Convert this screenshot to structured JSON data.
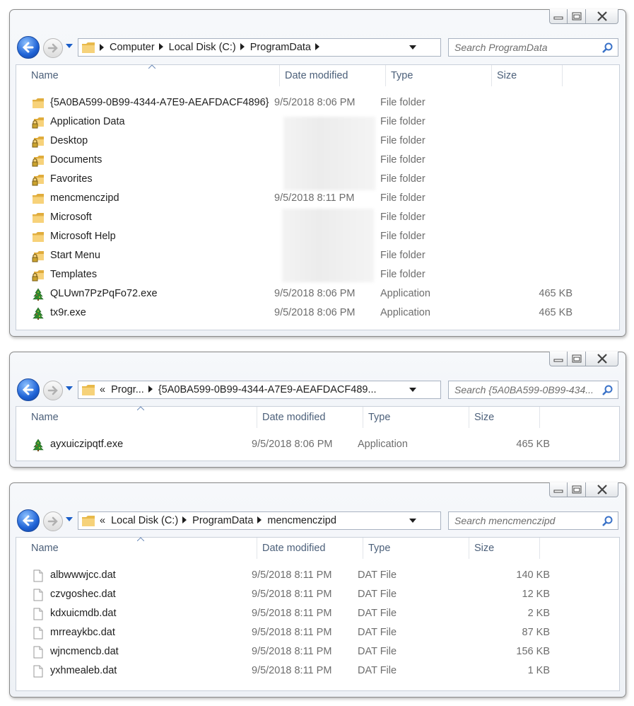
{
  "windows": [
    {
      "id": "w1",
      "address": [
        "Computer",
        "Local Disk (C:)",
        "ProgramData"
      ],
      "address_prefix": "",
      "search_placeholder": "Search ProgramData",
      "columns": {
        "name": "Name",
        "date": "Date modified",
        "type": "Type",
        "size": "Size"
      },
      "rows": [
        {
          "icon": "folder-icon",
          "name": "{5A0BA599-0B99-4344-A7E9-AEAFDACF4896}",
          "date": "9/5/2018 8:06 PM",
          "type": "File folder",
          "size": ""
        },
        {
          "icon": "locked-folder-icon",
          "name": "Application Data",
          "date": "",
          "type": "File folder",
          "size": ""
        },
        {
          "icon": "locked-folder-icon",
          "name": "Desktop",
          "date": "",
          "type": "File folder",
          "size": ""
        },
        {
          "icon": "locked-folder-icon",
          "name": "Documents",
          "date": "",
          "type": "File folder",
          "size": ""
        },
        {
          "icon": "locked-folder-icon",
          "name": "Favorites",
          "date": "",
          "type": "File folder",
          "size": ""
        },
        {
          "icon": "folder-icon",
          "name": "mencmenczipd",
          "date": "9/5/2018 8:11 PM",
          "type": "File folder",
          "size": ""
        },
        {
          "icon": "folder-icon",
          "name": "Microsoft",
          "date": "",
          "type": "File folder",
          "size": ""
        },
        {
          "icon": "folder-icon",
          "name": "Microsoft Help",
          "date": "",
          "type": "File folder",
          "size": ""
        },
        {
          "icon": "locked-folder-icon",
          "name": "Start Menu",
          "date": "",
          "type": "File folder",
          "size": ""
        },
        {
          "icon": "locked-folder-icon",
          "name": "Templates",
          "date": "",
          "type": "File folder",
          "size": ""
        },
        {
          "icon": "tree-app-icon",
          "name": "QLUwn7PzPqFo72.exe",
          "date": "9/5/2018 8:06 PM",
          "type": "Application",
          "size": "465 KB"
        },
        {
          "icon": "tree-app-icon",
          "name": "tx9r.exe",
          "date": "9/5/2018 8:06 PM",
          "type": "Application",
          "size": "465 KB"
        }
      ]
    },
    {
      "id": "w2",
      "address": [
        "Progr...",
        "{5A0BA599-0B99-4344-A7E9-AEAFDACF489..."
      ],
      "address_prefix": "«",
      "search_placeholder": "Search {5A0BA599-0B99-434...",
      "columns": {
        "name": "Name",
        "date": "Date modified",
        "type": "Type",
        "size": "Size"
      },
      "rows": [
        {
          "icon": "tree-app-icon",
          "name": "ayxuiczipqtf.exe",
          "date": "9/5/2018 8:06 PM",
          "type": "Application",
          "size": "465 KB"
        }
      ]
    },
    {
      "id": "w3",
      "address": [
        "Local Disk (C:)",
        "ProgramData",
        "mencmenczipd"
      ],
      "address_prefix": "«",
      "search_placeholder": "Search mencmenczipd",
      "columns": {
        "name": "Name",
        "date": "Date modified",
        "type": "Type",
        "size": "Size"
      },
      "rows": [
        {
          "icon": "file-icon",
          "name": "albwwwjcc.dat",
          "date": "9/5/2018 8:11 PM",
          "type": "DAT File",
          "size": "140 KB"
        },
        {
          "icon": "file-icon",
          "name": "czvgoshec.dat",
          "date": "9/5/2018 8:11 PM",
          "type": "DAT File",
          "size": "12 KB"
        },
        {
          "icon": "file-icon",
          "name": "kdxuicmdb.dat",
          "date": "9/5/2018 8:11 PM",
          "type": "DAT File",
          "size": "2 KB"
        },
        {
          "icon": "file-icon",
          "name": "mrreaykbc.dat",
          "date": "9/5/2018 8:11 PM",
          "type": "DAT File",
          "size": "87 KB"
        },
        {
          "icon": "file-icon",
          "name": "wjncmencb.dat",
          "date": "9/5/2018 8:11 PM",
          "type": "DAT File",
          "size": "156 KB"
        },
        {
          "icon": "file-icon",
          "name": "yxhmealeb.dat",
          "date": "9/5/2018 8:11 PM",
          "type": "DAT File",
          "size": "1 KB"
        }
      ]
    }
  ]
}
